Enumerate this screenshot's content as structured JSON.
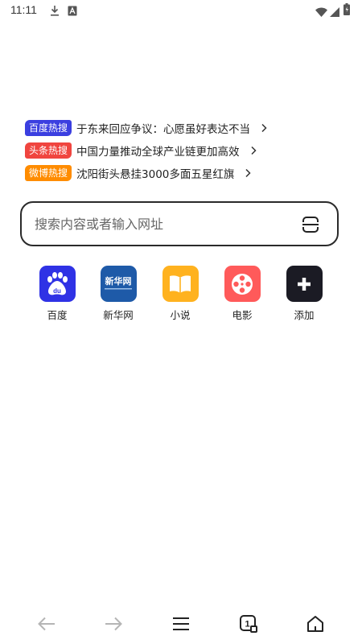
{
  "status_bar": {
    "time": "11:11",
    "icons": [
      "download-icon",
      "a-icon",
      "wifi-icon",
      "signal-icon",
      "battery-icon"
    ]
  },
  "hot_searches": [
    {
      "badge": "百度热搜",
      "text": "于东来回应争议：心愿虽好表达不当",
      "color": "#3b3fe0"
    },
    {
      "badge": "头条热搜",
      "text": "中国力量推动全球产业链更加高效",
      "color": "#f0453f"
    },
    {
      "badge": "微博热搜",
      "text": "沈阳街头悬挂3000多面五星红旗",
      "color": "#ff8c00"
    }
  ],
  "search": {
    "placeholder": "搜索内容或者输入网址",
    "icon": "scan-icon"
  },
  "quick_links": [
    {
      "label": "百度",
      "icon": "baidu-icon",
      "bg": "#2f32e5"
    },
    {
      "label": "新华网",
      "icon": "xinhua-icon",
      "bg": "#1e5aa8",
      "logo_text": "新华网"
    },
    {
      "label": "小说",
      "icon": "book-icon",
      "bg": "#ffb21f"
    },
    {
      "label": "电影",
      "icon": "film-icon",
      "bg": "#ff5a5a"
    },
    {
      "label": "添加",
      "icon": "plus-icon",
      "bg": "#1b1b24"
    }
  ],
  "bottom_nav": {
    "tab_count": "1",
    "icons": [
      "back-icon",
      "forward-icon",
      "menu-icon",
      "tabs-icon",
      "home-icon"
    ]
  }
}
